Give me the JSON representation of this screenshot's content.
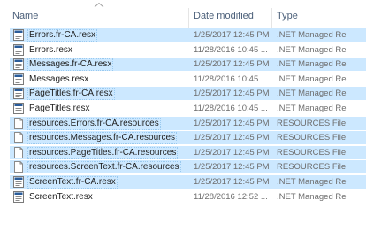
{
  "columns": {
    "name": "Name",
    "date_modified": "Date modified",
    "type": "Type"
  },
  "sort_icon": "chevron-up-icon",
  "file_icons": {
    "resx": "resx-file-icon",
    "resources": "blank-document-icon"
  },
  "colors": {
    "selection": "#cce8ff",
    "selection_border": "#99c9ef",
    "header_text": "#4c607a",
    "muted_text": "#6d6d6d"
  },
  "files": [
    {
      "name": "Errors.fr-CA.resx",
      "date": "1/25/2017 12:45 PM",
      "type": ".NET Managed Re",
      "icon": "resx",
      "selected": true
    },
    {
      "name": "Errors.resx",
      "date": "11/28/2016 10:45 ...",
      "type": ".NET Managed Re",
      "icon": "resx",
      "selected": false
    },
    {
      "name": "Messages.fr-CA.resx",
      "date": "1/25/2017 12:45 PM",
      "type": ".NET Managed Re",
      "icon": "resx",
      "selected": true
    },
    {
      "name": "Messages.resx",
      "date": "11/28/2016 10:45 ...",
      "type": ".NET Managed Re",
      "icon": "resx",
      "selected": false
    },
    {
      "name": "PageTitles.fr-CA.resx",
      "date": "1/25/2017 12:45 PM",
      "type": ".NET Managed Re",
      "icon": "resx",
      "selected": true
    },
    {
      "name": "PageTitles.resx",
      "date": "11/28/2016 10:45 ...",
      "type": ".NET Managed Re",
      "icon": "resx",
      "selected": false
    },
    {
      "name": "resources.Errors.fr-CA.resources",
      "date": "1/25/2017 12:45 PM",
      "type": "RESOURCES File",
      "icon": "resources",
      "selected": true
    },
    {
      "name": "resources.Messages.fr-CA.resources",
      "date": "1/25/2017 12:45 PM",
      "type": "RESOURCES File",
      "icon": "resources",
      "selected": true
    },
    {
      "name": "resources.PageTitles.fr-CA.resources",
      "date": "1/25/2017 12:45 PM",
      "type": "RESOURCES File",
      "icon": "resources",
      "selected": true
    },
    {
      "name": "resources.ScreenText.fr-CA.resources",
      "date": "1/25/2017 12:45 PM",
      "type": "RESOURCES File",
      "icon": "resources",
      "selected": true
    },
    {
      "name": "ScreenText.fr-CA.resx",
      "date": "1/25/2017 12:45 PM",
      "type": ".NET Managed Re",
      "icon": "resx",
      "selected": true
    },
    {
      "name": "ScreenText.resx",
      "date": "11/28/2016 12:52 ...",
      "type": ".NET Managed Re",
      "icon": "resx",
      "selected": false
    }
  ]
}
